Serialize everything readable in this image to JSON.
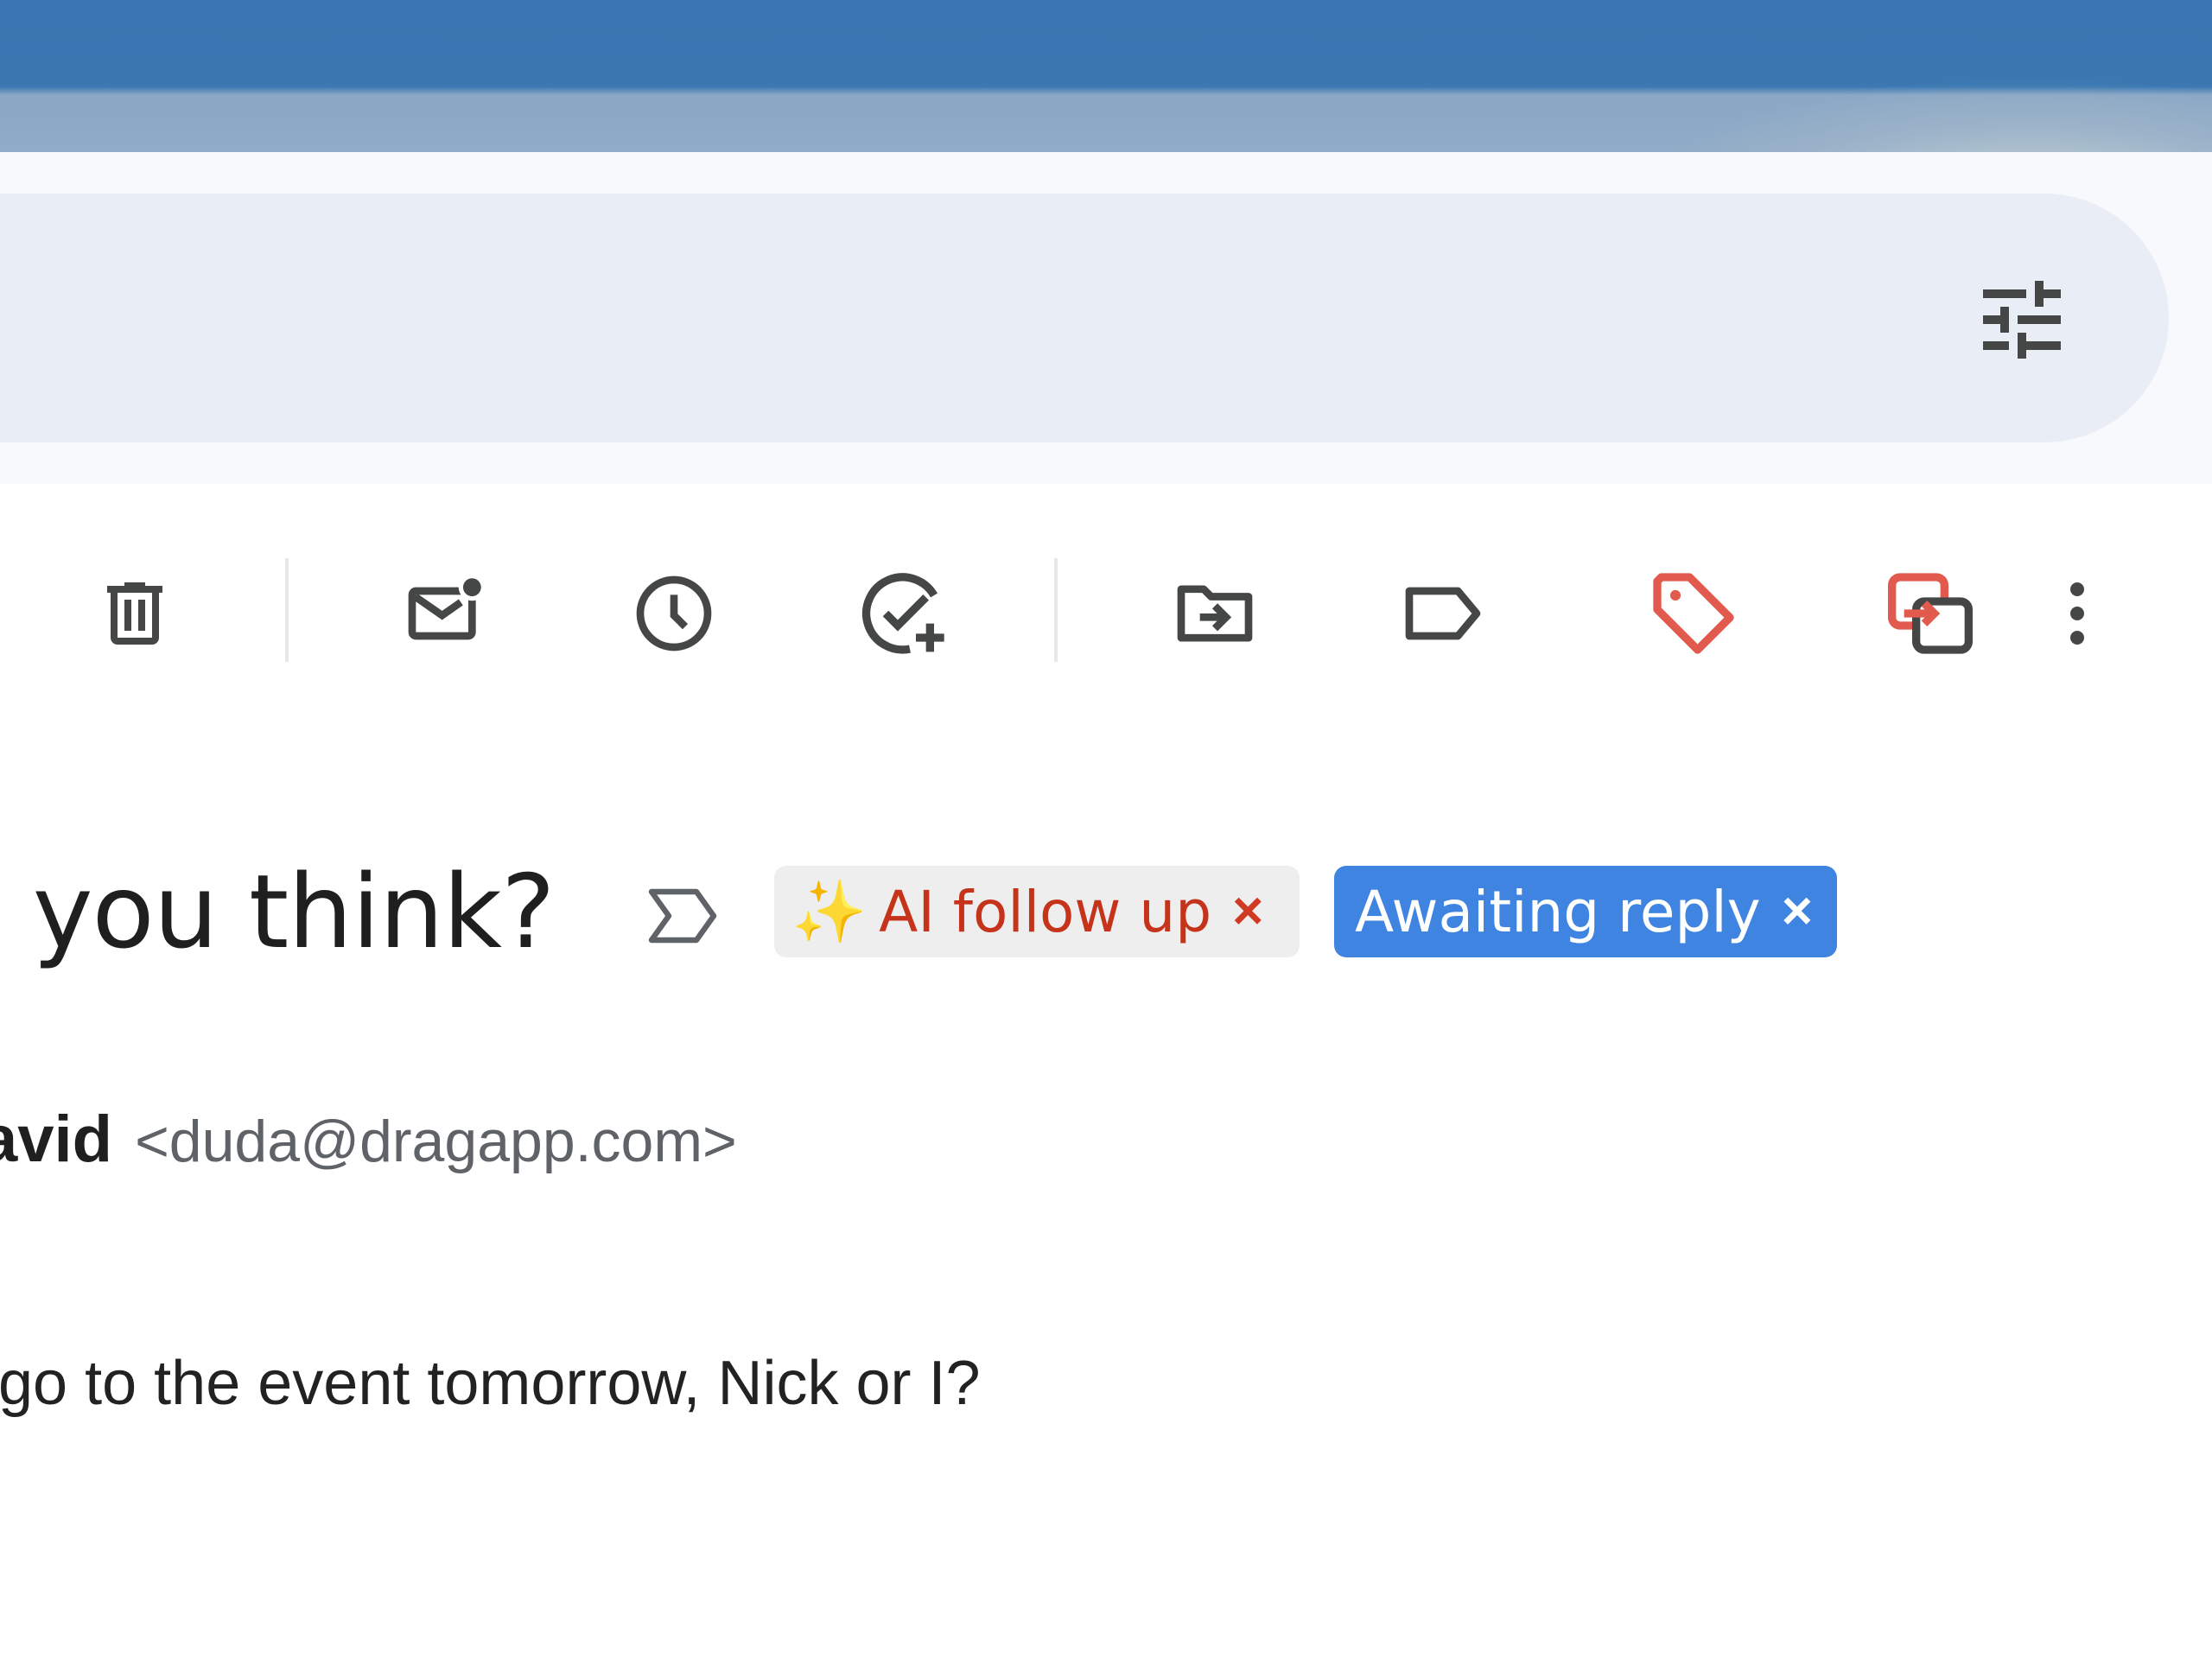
{
  "colors": {
    "accent_blue": "#3f84e0",
    "ai_chip_text": "#c5331b",
    "tag_red": "#e25a4d",
    "icon_gray": "#444746"
  },
  "search": {
    "options_icon": "tune-icon"
  },
  "toolbar": {
    "icons": [
      "delete-icon",
      "mark-unread-icon",
      "snooze-icon",
      "add-task-icon",
      "move-to-icon",
      "label-icon",
      "tag-icon",
      "switch-icon",
      "more-vert-icon"
    ]
  },
  "email": {
    "subject": "o you think?",
    "importance_icon": "importance-marker-icon",
    "labels": [
      {
        "icon": "✨",
        "text": "AI follow up",
        "remove": "×"
      },
      {
        "text": "Awaiting reply",
        "remove": "×"
      }
    ],
    "sender_name": "avid",
    "sender_email": "<duda@dragapp.com>",
    "body": "go to the event tomorrow, Nick or I?"
  }
}
